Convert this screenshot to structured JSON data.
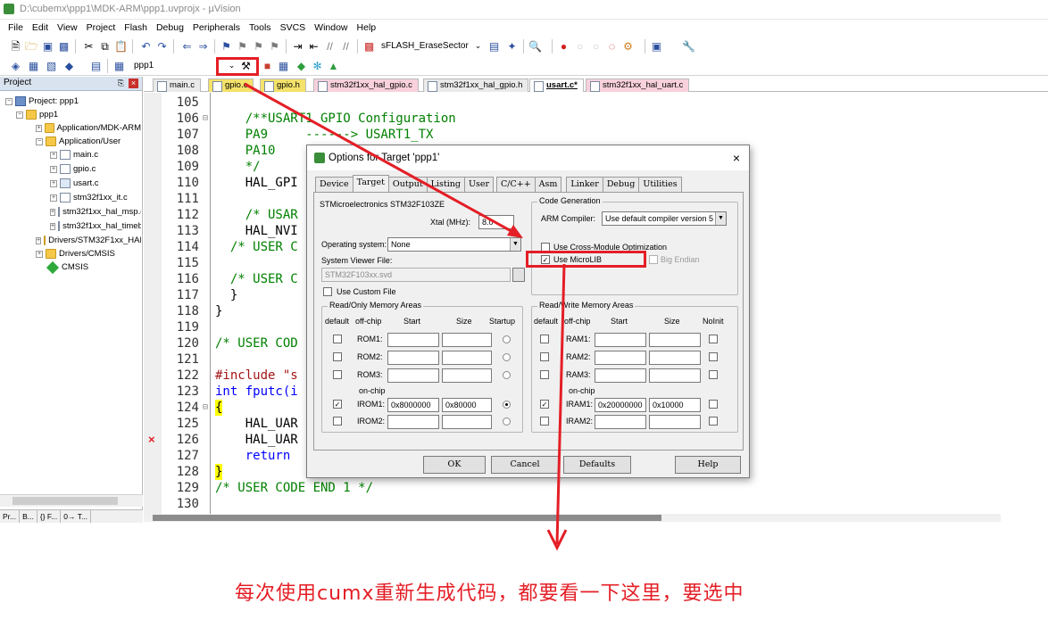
{
  "window": {
    "title": "D:\\cubemx\\ppp1\\MDK-ARM\\ppp1.uvprojx - µVision"
  },
  "menu": [
    "File",
    "Edit",
    "View",
    "Project",
    "Flash",
    "Debug",
    "Peripherals",
    "Tools",
    "SVCS",
    "Window",
    "Help"
  ],
  "toolbar": {
    "flash_combo": "sFLASH_EraseSector",
    "target_combo": "ppp1"
  },
  "project_pane": {
    "header": "Project",
    "items": [
      {
        "label": "Project: ppp1",
        "level": 0
      },
      {
        "label": "ppp1",
        "level": 1
      },
      {
        "label": "Application/MDK-ARM",
        "level": 2
      },
      {
        "label": "Application/User",
        "level": 2
      },
      {
        "label": "main.c",
        "level": 3
      },
      {
        "label": "gpio.c",
        "level": 3
      },
      {
        "label": "usart.c",
        "level": 3
      },
      {
        "label": "stm32f1xx_it.c",
        "level": 3
      },
      {
        "label": "stm32f1xx_hal_msp.c",
        "level": 3
      },
      {
        "label": "stm32f1xx_hal_timebase_tim.c",
        "level": 3
      },
      {
        "label": "Drivers/STM32F1xx_HAL_Driver",
        "level": 2
      },
      {
        "label": "Drivers/CMSIS",
        "level": 2
      },
      {
        "label": "CMSIS",
        "level": 2
      }
    ],
    "footer_tabs": [
      "Pr...",
      "B...",
      "{} F...",
      "0→ T..."
    ]
  },
  "editor_tabs": [
    {
      "label": "main.c",
      "style": "plain"
    },
    {
      "label": "gpio.c",
      "style": "yellow"
    },
    {
      "label": "gpio.h",
      "style": "yellow"
    },
    {
      "label": "stm32f1xx_hal_gpio.c",
      "style": "pink"
    },
    {
      "label": "stm32f1xx_hal_gpio.h",
      "style": "plain"
    },
    {
      "label": "usart.c*",
      "style": "active"
    },
    {
      "label": "stm32f1xx_hal_uart.c",
      "style": "pink"
    }
  ],
  "code_lines": [
    {
      "num": "105",
      "fold": "",
      "text": ""
    },
    {
      "num": "106",
      "fold": "⊟",
      "text": "    /**USART1 GPIO Configuration"
    },
    {
      "num": "107",
      "fold": "",
      "text": "    PA9     ------> USART1_TX"
    },
    {
      "num": "108",
      "fold": "",
      "text": "    PA10    ------> USART1_RX"
    },
    {
      "num": "109",
      "fold": "",
      "text": "    */"
    },
    {
      "num": "110",
      "fold": "",
      "text": "    HAL_GPI"
    },
    {
      "num": "111",
      "fold": "",
      "text": ""
    },
    {
      "num": "112",
      "fold": "",
      "text": "    /* USAR"
    },
    {
      "num": "113",
      "fold": "",
      "text": "    HAL_NVI"
    },
    {
      "num": "114",
      "fold": "",
      "text": "  /* USER C"
    },
    {
      "num": "115",
      "fold": "",
      "text": ""
    },
    {
      "num": "116",
      "fold": "",
      "text": "  /* USER C"
    },
    {
      "num": "117",
      "fold": "",
      "text": "  }"
    },
    {
      "num": "118",
      "fold": "",
      "text": "}"
    },
    {
      "num": "119",
      "fold": "",
      "text": ""
    },
    {
      "num": "120",
      "fold": "",
      "text": "/* USER COD"
    },
    {
      "num": "121",
      "fold": "",
      "text": ""
    },
    {
      "num": "122",
      "fold": "",
      "text": "#include \"s"
    },
    {
      "num": "123",
      "fold": "",
      "text": "int fputc(i"
    },
    {
      "num": "124",
      "fold": "⊟",
      "text": "{"
    },
    {
      "num": "125",
      "fold": "",
      "text": "    HAL_UAR"
    },
    {
      "num": "126",
      "fold": "",
      "text": "    HAL_UAR"
    },
    {
      "num": "127",
      "fold": "",
      "text": "    return"
    },
    {
      "num": "128",
      "fold": "",
      "text": "}"
    },
    {
      "num": "129",
      "fold": "",
      "text": "/* USER CODE END 1 */"
    },
    {
      "num": "130",
      "fold": "",
      "text": ""
    }
  ],
  "dialog": {
    "title": "Options for Target 'ppp1'",
    "close": "×",
    "tabs": [
      "Device",
      "Target",
      "Output",
      "Listing",
      "User",
      "C/C++",
      "Asm",
      "Linker",
      "Debug",
      "Utilities"
    ],
    "active_tab": "Target",
    "device_name": "STMicroelectronics STM32F103ZE",
    "xtal_label": "Xtal (MHz):",
    "xtal_value": "8.0",
    "os_label": "Operating system:",
    "os_value": "None",
    "svd_label": "System Viewer File:",
    "svd_value": "STM32F103xx.svd",
    "custom_file_label": "Use Custom File",
    "codegen": {
      "group": "Code Generation",
      "compiler_label": "ARM Compiler:",
      "compiler_value": "Use default compiler version 5",
      "cross_module": "Use Cross-Module Optimization",
      "microlib": "Use MicroLIB",
      "big_endian": "Big Endian"
    },
    "rom": {
      "group": "Read/Only Memory Areas",
      "headers": [
        "default",
        "off-chip",
        "Start",
        "Size",
        "Startup"
      ],
      "rows": [
        {
          "label": "ROM1:",
          "start": "",
          "size": "",
          "checked": false,
          "startup": false
        },
        {
          "label": "ROM2:",
          "start": "",
          "size": "",
          "checked": false,
          "startup": false
        },
        {
          "label": "ROM3:",
          "start": "",
          "size": "",
          "checked": false,
          "startup": false
        },
        {
          "label": "IROM1:",
          "start": "0x8000000",
          "size": "0x80000",
          "checked": true,
          "startup": true
        },
        {
          "label": "IROM2:",
          "start": "",
          "size": "",
          "checked": false,
          "startup": false
        }
      ],
      "onchip": "on-chip"
    },
    "ram": {
      "group": "Read/Write Memory Areas",
      "headers": [
        "default",
        "off-chip",
        "Start",
        "Size",
        "NoInit"
      ],
      "rows": [
        {
          "label": "RAM1:",
          "start": "",
          "size": ""
        },
        {
          "label": "RAM2:",
          "start": "",
          "size": ""
        },
        {
          "label": "RAM3:",
          "start": "",
          "size": ""
        },
        {
          "label": "IRAM1:",
          "start": "0x20000000",
          "size": "0x10000"
        },
        {
          "label": "IRAM2:",
          "start": "",
          "size": ""
        }
      ],
      "onchip": "on-chip"
    },
    "buttons": {
      "ok": "OK",
      "cancel": "Cancel",
      "defaults": "Defaults",
      "help": "Help"
    }
  },
  "annotation": {
    "text": "每次使用cumx重新生成代码，都要看一下这里，要选中",
    "color": "#e41e26"
  }
}
